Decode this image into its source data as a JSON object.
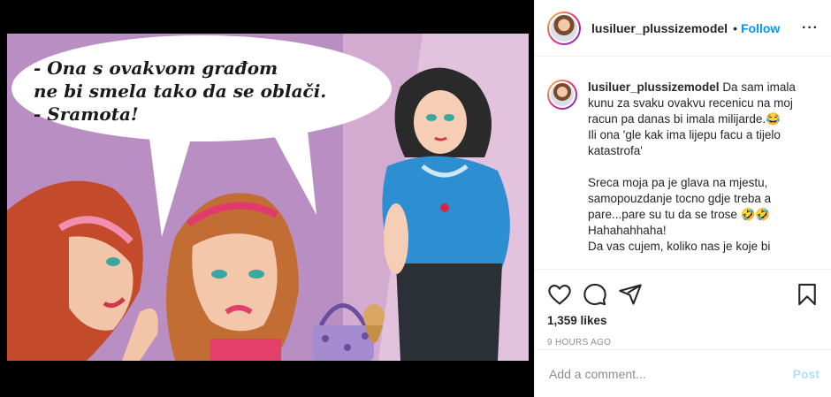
{
  "post": {
    "image_text": [
      "- Ona s ovakvom građom",
      "ne bi smela tako da se oblači.",
      "- Sramota!"
    ]
  },
  "header": {
    "username": "lusiluer_plussizemodel",
    "separator": "•",
    "follow_label": "Follow",
    "more_label": "···"
  },
  "caption": {
    "username": "lusiluer_plussizemodel",
    "lines": [
      "Da sam imala",
      "kunu za svaku ovakvu recenicu na moj",
      "racun pa danas bi imala milijarde.😂",
      "Ili ona 'gle kak ima lijepu facu a tijelo",
      "katastrofa'",
      "",
      "Sreca moja pa je glava na mjestu,",
      "samopouzdanje tocno gdje treba a",
      "pare...pare su tu da se trose 🤣🤣",
      "Hahahahhaha!",
      "Da vas cujem, koliko nas je koje bi"
    ]
  },
  "actions": {
    "likes": "1,359 likes",
    "time": "9 HOURS AGO"
  },
  "add_comment": {
    "placeholder": "Add a comment...",
    "post_label": "Post"
  },
  "icons": {
    "like": "heart-icon",
    "comment": "comment-icon",
    "share": "share-icon",
    "save": "bookmark-icon"
  },
  "colors": {
    "link": "#0095f6",
    "post_disabled": "#b2dffc",
    "muted": "#8e8e8e",
    "text": "#262626"
  }
}
